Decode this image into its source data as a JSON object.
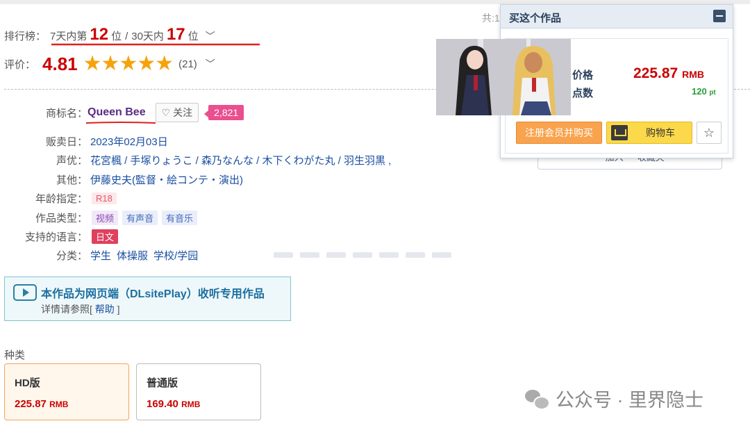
{
  "ranking": {
    "label": "排行榜：",
    "week_prefix": "7天内第",
    "week_rank": "12",
    "week_suffix": "位",
    "month_prefix": "30天内",
    "month_rank": "17",
    "month_suffix": "位"
  },
  "rating": {
    "label": "评价：",
    "value": "4.81",
    "stars": "★★★★★",
    "count": "(21)"
  },
  "details": {
    "brand_label": "商标名：",
    "brand": "Queen Bee",
    "follow": "关注",
    "follow_count": "2,821",
    "release_label": "贩卖日：",
    "release": "2023年02月03日",
    "cast_label": "声优：",
    "cast": "花宮楓 / 手塚りょうこ / 森乃なんな / 木下くわがた丸 / 羽生羽黒 ,",
    "other_label": "其他：",
    "other": "伊藤史夫(監督・絵コンテ・演出)",
    "age_label": "年龄指定：",
    "age": "R18",
    "type_label": "作品类型：",
    "types": [
      "视频",
      "有声音",
      "有音乐"
    ],
    "lang_label": "支持的语言：",
    "lang": "日文",
    "genre_label": "分类：",
    "genres": [
      "学生",
      "体操服",
      "学校/学园"
    ]
  },
  "play_notice": {
    "title": "本作品为网页端（DLsitePlay）收听专用作品",
    "sub_prefix": "详情请参照[",
    "help": "帮助",
    "sub_suffix": "]"
  },
  "editions": {
    "label": "种类",
    "items": [
      {
        "name": "HD版",
        "price": "225.87",
        "unit": "RMB"
      },
      {
        "name": "普通版",
        "price": "169.40",
        "unit": "RMB"
      }
    ]
  },
  "buy_panel": {
    "total_label": "共:1",
    "title": "买这个作品",
    "price_label": "价格",
    "points_label": "点数",
    "price": "225.87",
    "currency": "RMB",
    "points": "120",
    "points_unit": "pt",
    "member_button": "注册会员并购买",
    "cart_button": "购物车",
    "fav_icon": "star-outline-icon",
    "under_text": "一 加入 一 收藏夹"
  },
  "watermark": "公众号 · 里界隐士",
  "colors": {
    "rank_red": "#cc0000",
    "star": "#f5a30b",
    "brand_purple": "#5b2a86",
    "follow_badge": "#ea4f8f",
    "member_btn": "#f9a34e",
    "cart_btn": "#fcd94a",
    "points_green": "#2a9d3a"
  }
}
